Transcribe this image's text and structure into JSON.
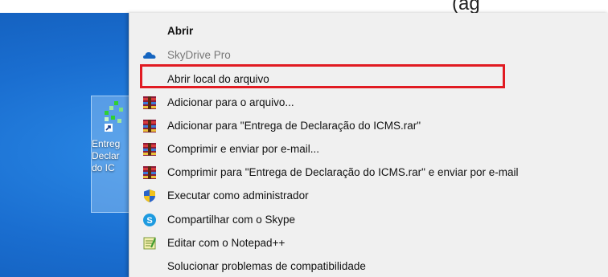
{
  "top_caption": "(ag",
  "desktop_icon": {
    "label": "Entreg\nDeclar\ndo IC"
  },
  "menu": {
    "items": [
      {
        "label": "Abrir",
        "icon": "none",
        "style": "bold"
      },
      {
        "label": "SkyDrive Pro",
        "icon": "cloud-icon",
        "style": "disabled"
      },
      {
        "label": "Abrir local do arquivo",
        "icon": "none",
        "style": "normal",
        "highlighted": true
      },
      {
        "label": "Adicionar para o arquivo...",
        "icon": "winrar-icon",
        "style": "normal"
      },
      {
        "label": "Adicionar para \"Entrega de Declaração do ICMS.rar\"",
        "icon": "winrar-icon",
        "style": "normal"
      },
      {
        "label": "Comprimir e enviar por e-mail...",
        "icon": "winrar-icon",
        "style": "normal"
      },
      {
        "label": "Comprimir para \"Entrega de Declaração do ICMS.rar\" e enviar por e-mail",
        "icon": "winrar-icon",
        "style": "normal"
      },
      {
        "label": "Executar como administrador",
        "icon": "shield-icon",
        "style": "normal"
      },
      {
        "label": "Compartilhar com o Skype",
        "icon": "skype-icon",
        "style": "normal"
      },
      {
        "label": "Editar com o Notepad++",
        "icon": "notepad-icon",
        "style": "normal"
      },
      {
        "label": "Solucionar problemas de compatibilidade",
        "icon": "none",
        "style": "normal"
      }
    ]
  },
  "colors": {
    "highlight_border": "#e11b22",
    "desktop": "#1a6ed0",
    "menu_bg": "#f0f0f0"
  }
}
